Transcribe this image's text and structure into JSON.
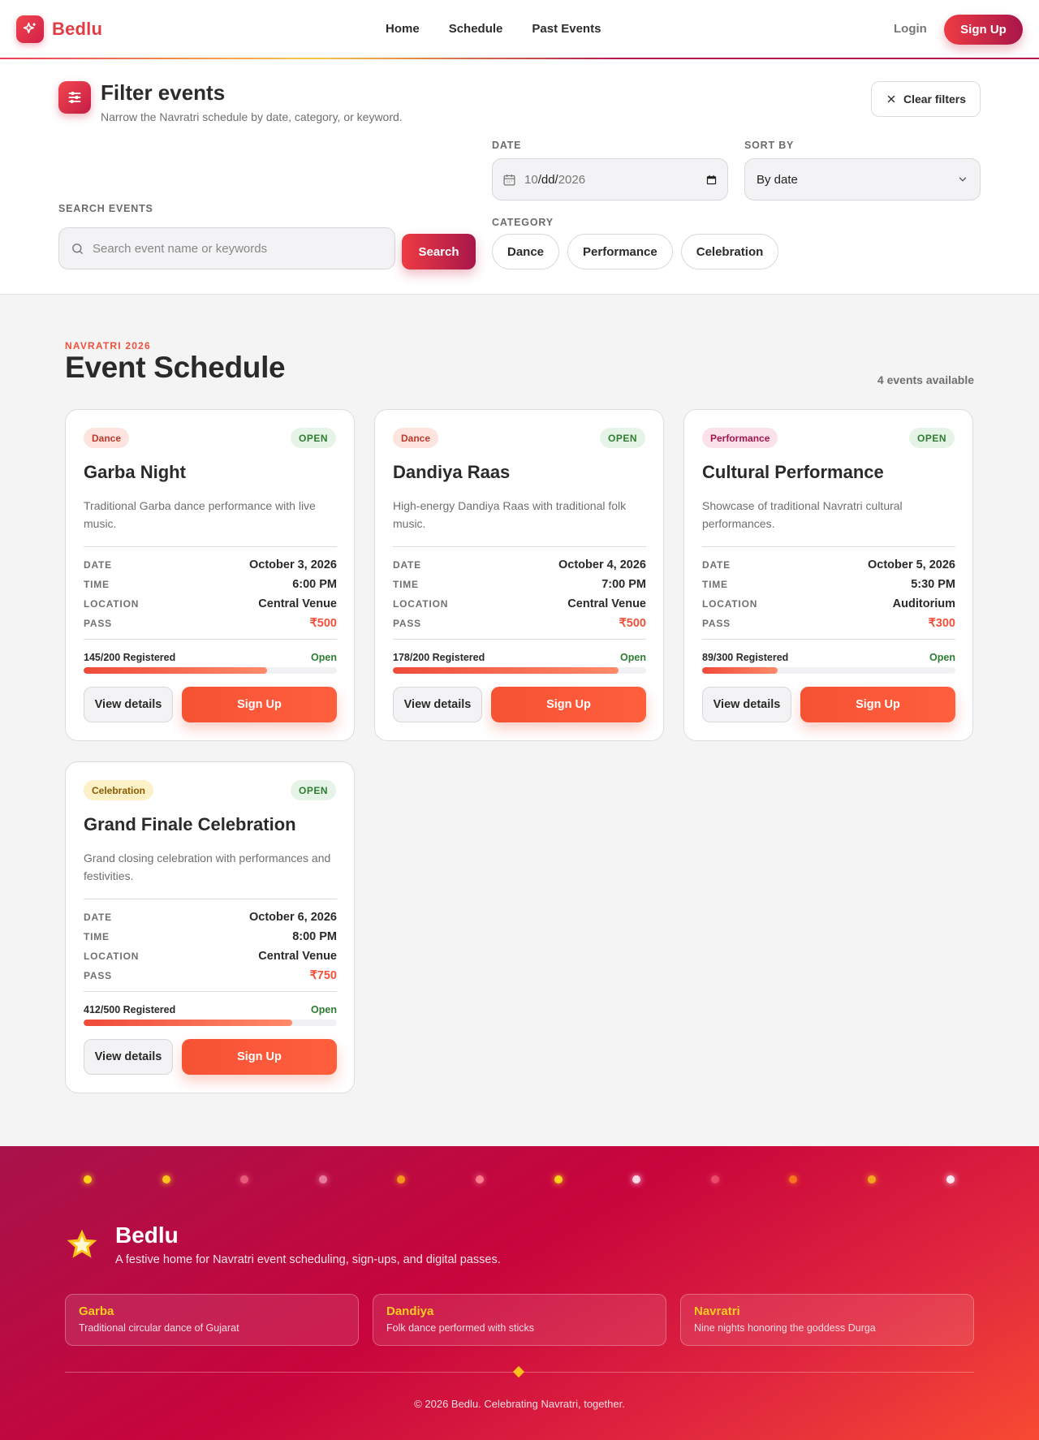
{
  "nav": {
    "brand": "Bedlu",
    "links": [
      "Home",
      "Schedule",
      "Past Events"
    ],
    "login": "Login",
    "signup": "Sign Up"
  },
  "filter": {
    "title": "Filter events",
    "subtitle": "Narrow the Navratri schedule by date, category, or keyword.",
    "clear_label": "Clear filters",
    "date_label": "DATE",
    "date_value_month": "10",
    "date_value_day": "dd",
    "date_value_year": "2026",
    "sort_label": "SORT BY",
    "sort_value": "By date",
    "search_label": "SEARCH EVENTS",
    "search_placeholder": "Search event name or keywords",
    "search_button": "Search",
    "category_label": "CATEGORY",
    "categories": [
      "Dance",
      "Performance",
      "Celebration"
    ]
  },
  "schedule": {
    "eyebrow": "NAVRATRI 2026",
    "title": "Event Schedule",
    "count_text": "4 events available",
    "row_labels": {
      "date": "DATE",
      "time": "TIME",
      "location": "LOCATION",
      "pass": "PASS"
    },
    "events": [
      {
        "tag": "Dance",
        "status": "OPEN",
        "title": "Garba Night",
        "desc": "Traditional Garba dance performance with live music.",
        "date": "October 3, 2026",
        "time": "6:00 PM",
        "location": "Central Venue",
        "pass": "₹500",
        "registered": "145/200 Registered",
        "reg_status": "Open",
        "progress": 0.725,
        "view": "View details",
        "signup": "Sign Up"
      },
      {
        "tag": "Dance",
        "status": "OPEN",
        "title": "Dandiya Raas",
        "desc": "High-energy Dandiya Raas with traditional folk music.",
        "date": "October 4, 2026",
        "time": "7:00 PM",
        "location": "Central Venue",
        "pass": "₹500",
        "registered": "178/200 Registered",
        "reg_status": "Open",
        "progress": 0.89,
        "view": "View details",
        "signup": "Sign Up"
      },
      {
        "tag": "Performance",
        "status": "OPEN",
        "title": "Cultural Performance",
        "desc": "Showcase of traditional Navratri cultural performances.",
        "date": "October 5, 2026",
        "time": "5:30 PM",
        "location": "Auditorium",
        "pass": "₹300",
        "registered": "89/300 Registered",
        "reg_status": "Open",
        "progress": 0.2967,
        "view": "View details",
        "signup": "Sign Up"
      },
      {
        "tag": "Celebration",
        "status": "OPEN",
        "title": "Grand Finale Celebration",
        "desc": "Grand closing celebration with performances and festivities.",
        "date": "October 6, 2026",
        "time": "8:00 PM",
        "location": "Central Venue",
        "pass": "₹750",
        "registered": "412/500 Registered",
        "reg_status": "Open",
        "progress": 0.824,
        "view": "View details",
        "signup": "Sign Up"
      }
    ]
  },
  "footer": {
    "brand": "Bedlu",
    "tagline": "A festive home for Navratri event scheduling, sign-ups, and digital passes.",
    "boxes": [
      {
        "title": "Garba",
        "desc": "Traditional circular dance of Gujarat"
      },
      {
        "title": "Dandiya",
        "desc": "Folk dance performed with sticks"
      },
      {
        "title": "Navratri",
        "desc": "Nine nights honoring the goddess Durga"
      }
    ],
    "copyright": "© 2026 Bedlu. Celebrating Navratri, together."
  },
  "colors": {
    "accent": "#f0513a",
    "brand": "#e23c45",
    "open_green": "#2e7d32",
    "footer_gold": "#ffcc1f"
  },
  "icons": [
    "sparkle-logo-icon",
    "sliders-icon",
    "close-icon",
    "calendar-icon",
    "chevron-down-icon",
    "search-icon",
    "star-icon"
  ]
}
